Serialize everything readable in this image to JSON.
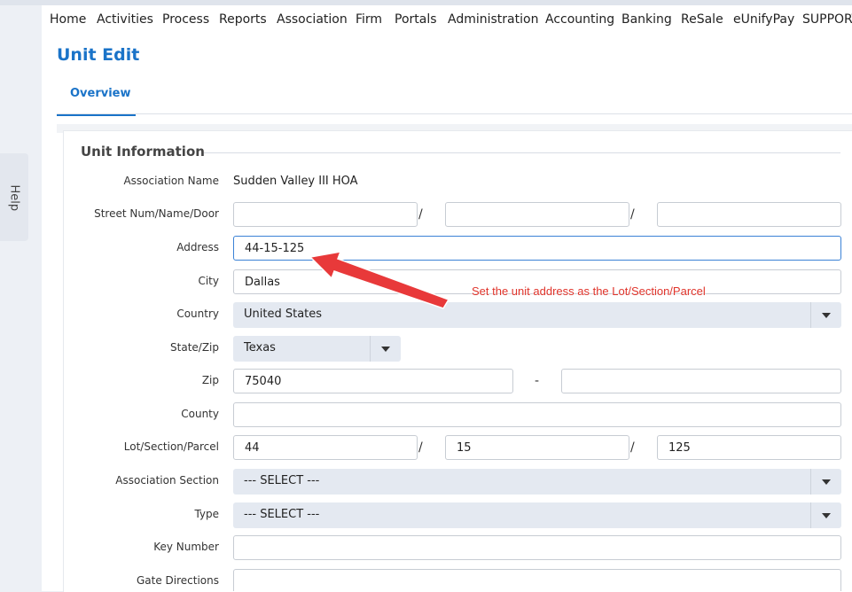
{
  "nav": [
    "Home",
    "Activities",
    "Process",
    "Reports",
    "Association",
    "Firm",
    "Portals",
    "Administration",
    "Accounting",
    "Banking",
    "ReSale",
    "eUnifyPay",
    "SUPPORT"
  ],
  "page": {
    "title": "Unit Edit",
    "tab": "Overview"
  },
  "help_label": "Help",
  "section": {
    "title": "Unit Information"
  },
  "labels": {
    "association_name": "Association Name",
    "street": "Street Num/Name/Door",
    "address": "Address",
    "city": "City",
    "country": "Country",
    "state_zip": "State/Zip",
    "zip": "Zip",
    "county": "County",
    "lot": "Lot/Section/Parcel",
    "assoc_section": "Association Section",
    "type": "Type",
    "key_number": "Key Number",
    "gate_directions": "Gate Directions"
  },
  "values": {
    "association_name": "Sudden Valley III HOA",
    "street_num": "",
    "street_name": "",
    "street_door": "",
    "address": "44-15-125",
    "city": "Dallas",
    "country": "United States",
    "state": "Texas",
    "zip": "75040",
    "zip_ext": "",
    "county": "",
    "lot": "44",
    "section": "15",
    "parcel": "125",
    "assoc_section": "--- SELECT ---",
    "type": "--- SELECT ---",
    "key_number": "",
    "gate_directions": ""
  },
  "separators": {
    "slash": "/",
    "dash": "-"
  },
  "annotation": {
    "text": "Set the unit address as the Lot/Section/Parcel",
    "color": "#e0342b"
  },
  "colors": {
    "accent": "#1a73c8",
    "select_bg": "#e4e9f1"
  }
}
